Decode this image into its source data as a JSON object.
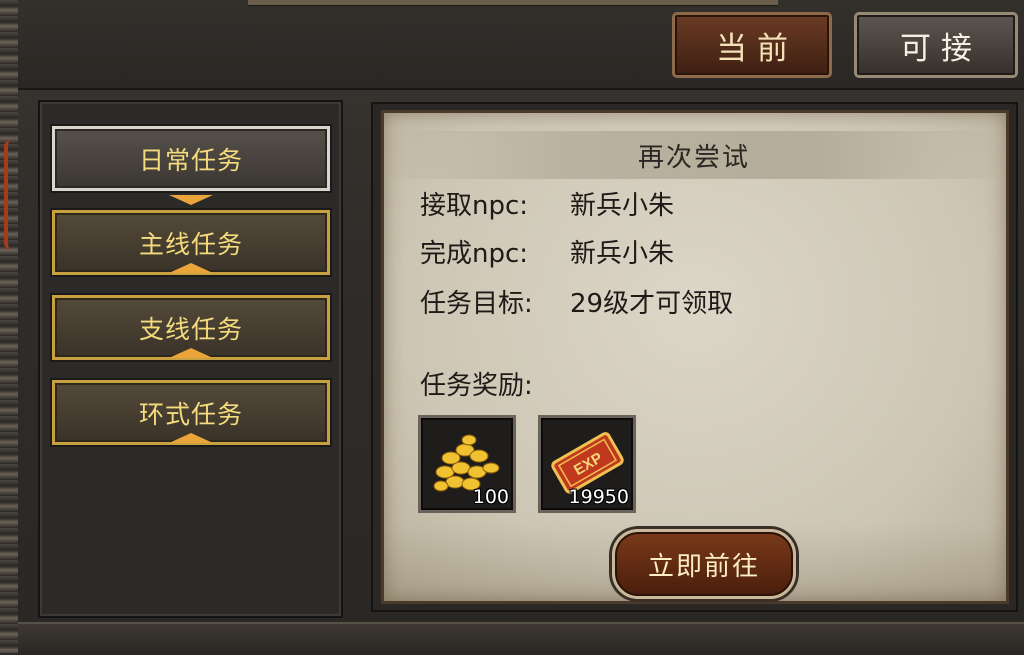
{
  "tabs": {
    "current": "当前",
    "available": "可接"
  },
  "categories": [
    {
      "label": "日常任务",
      "selected": true
    },
    {
      "label": "主线任务",
      "selected": false
    },
    {
      "label": "支线任务",
      "selected": false
    },
    {
      "label": "环式任务",
      "selected": false
    }
  ],
  "quest": {
    "title": "再次尝试",
    "accept_npc_label": "接取npc:",
    "accept_npc": "新兵小朱",
    "finish_npc_label": "完成npc:",
    "finish_npc": "新兵小朱",
    "objective_label": "任务目标:",
    "objective": "29级才可领取",
    "rewards_label": "任务奖励:",
    "rewards": [
      {
        "icon": "gold-coins-icon",
        "count": "100"
      },
      {
        "icon": "exp-scroll-icon",
        "count": "19950"
      }
    ],
    "go_button": "立即前往"
  },
  "colors": {
    "accent_gold": "#e9a43a",
    "category_text": "#f4dc7e",
    "button_red": "#6b3b24"
  }
}
